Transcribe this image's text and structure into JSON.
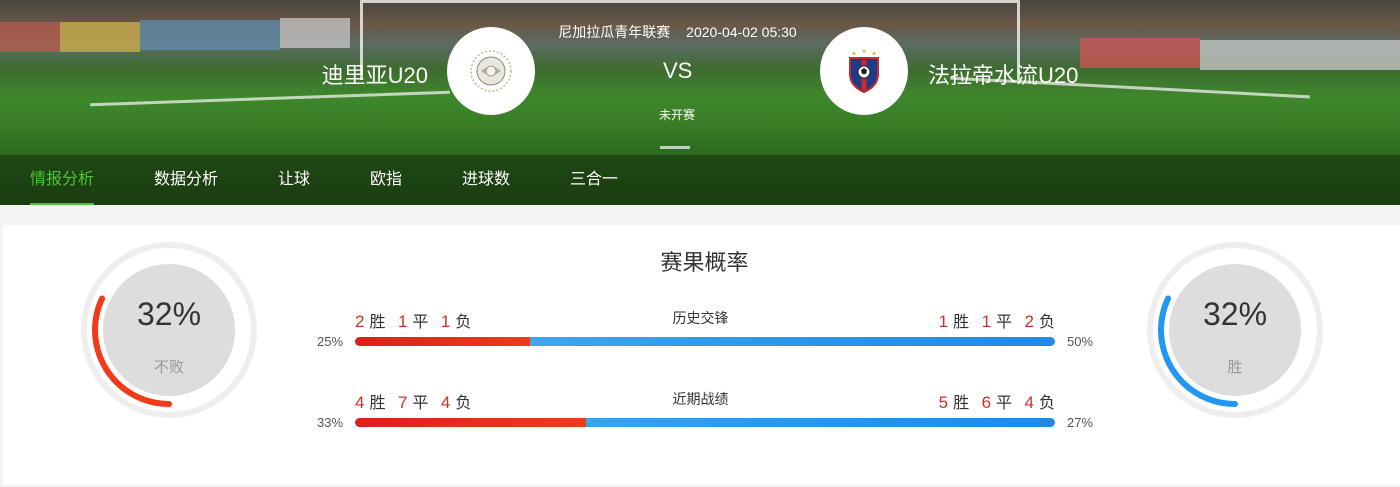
{
  "match": {
    "league": "尼加拉瓜青年联赛",
    "datetime": "2020-04-02 05:30",
    "home_team": "迪里亚U20",
    "away_team": "法拉帝水流U20",
    "vs": "VS",
    "status": "未开赛"
  },
  "tabs": [
    {
      "label": "情报分析",
      "active": true
    },
    {
      "label": "数据分析",
      "active": false
    },
    {
      "label": "让球",
      "active": false
    },
    {
      "label": "欧指",
      "active": false
    },
    {
      "label": "进球数",
      "active": false
    },
    {
      "label": "三合一",
      "active": false
    }
  ],
  "probability": {
    "title": "赛果概率",
    "left_gauge": {
      "percent": "32%",
      "label": "不败",
      "value": 0.32,
      "color": "#f03a1a"
    },
    "right_gauge": {
      "percent": "32%",
      "label": "胜",
      "value": 0.32,
      "color": "#2196f3"
    }
  },
  "rows": [
    {
      "title": "历史交锋",
      "left": {
        "win": "2",
        "draw": "1",
        "loss": "1",
        "pct": "25%"
      },
      "right": {
        "win": "1",
        "draw": "1",
        "loss": "2",
        "pct": "50%"
      },
      "fill": 0.25
    },
    {
      "title": "近期战绩",
      "left": {
        "win": "4",
        "draw": "7",
        "loss": "4",
        "pct": "33%"
      },
      "right": {
        "win": "5",
        "draw": "6",
        "loss": "4",
        "pct": "27%"
      },
      "fill": 0.33
    }
  ],
  "words": {
    "win": "胜",
    "draw": "平",
    "loss": "负"
  },
  "icons": {
    "home_logo": "globe-crest-icon",
    "away_logo": "shield-crest-icon"
  }
}
